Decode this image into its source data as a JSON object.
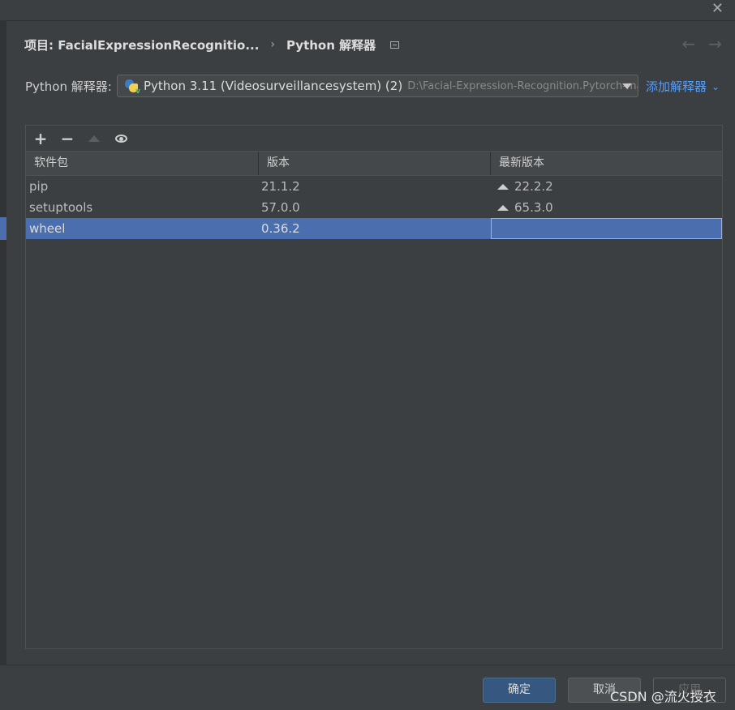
{
  "dialog": {
    "close_glyph": "✕"
  },
  "breadcrumb": {
    "project": "项目: FacialExpressionRecognitio...",
    "separator": "›",
    "page": "Python 解释器"
  },
  "nav": {
    "back": "←",
    "forward": "→"
  },
  "interpreter": {
    "label": "Python 解释器:",
    "name": "Python 3.11 (Videosurveillancesystem) (2)",
    "path": "D:\\Facial-Expression-Recognition.Pytorch-ma",
    "add_label": "添加解释器",
    "add_chevron": "⌄"
  },
  "toolbar": {
    "add": "+",
    "remove": "−"
  },
  "table": {
    "headers": [
      "软件包",
      "版本",
      "最新版本"
    ],
    "rows": [
      {
        "name": "pip",
        "version": "21.1.2",
        "latest": "22.2.2",
        "upgrade": true
      },
      {
        "name": "setuptools",
        "version": "57.0.0",
        "latest": "65.3.0",
        "upgrade": true
      },
      {
        "name": "wheel",
        "version": "0.36.2",
        "latest": "",
        "upgrade": false,
        "selected": true
      }
    ]
  },
  "footer": {
    "ok": "确定",
    "cancel": "取消",
    "apply": "应用"
  },
  "watermark": "CSDN @流火授衣",
  "colors": {
    "background": "#3c3f41",
    "selection": "#4b6eaf",
    "link": "#589df6",
    "primary_button": "#365880"
  },
  "icons": {
    "add": "plus-icon",
    "remove": "minus-icon",
    "upgrade": "triangle-up-icon",
    "show_early": "eye-icon",
    "interpreter": "python-icon"
  }
}
